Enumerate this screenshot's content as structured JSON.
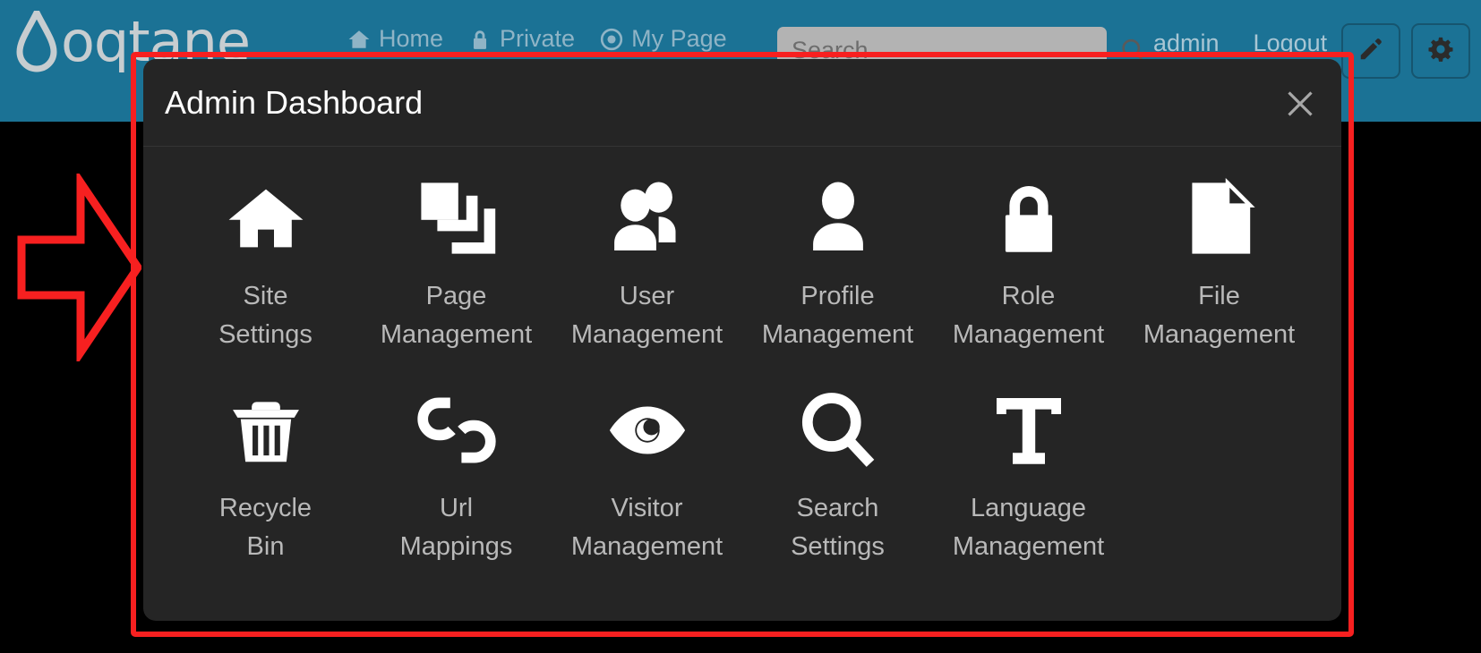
{
  "colors": {
    "header_bg": "#1b7295",
    "modal_bg": "#252525",
    "page_bg": "#000000",
    "annotation_red": "#f72020",
    "label_gray": "#b9b9b9",
    "nav_gray": "#8fb4c6",
    "icon_white": "#ffffff",
    "search_bg": "#b3b3b3"
  },
  "header": {
    "brand": {
      "wordmark": "oqtane",
      "logo_icon": "water-drop-icon"
    },
    "nav": [
      {
        "label": "Home",
        "icon": "home-icon"
      },
      {
        "label": "Private",
        "icon": "lock-icon"
      },
      {
        "label": "My Page",
        "icon": "target-circle-icon"
      }
    ],
    "search": {
      "value": "",
      "placeholder": "Search",
      "icon": "search-icon"
    },
    "user": {
      "username": "admin",
      "logout_label": "Logout"
    },
    "actions": [
      {
        "name": "edit-mode-button",
        "icon": "pencil-icon"
      },
      {
        "name": "site-settings-button",
        "icon": "gear-icon"
      }
    ]
  },
  "modal": {
    "title": "Admin Dashboard",
    "close_icon": "close-icon",
    "close_label": "×",
    "tiles": [
      {
        "label": "Site\nSettings",
        "label_line1": "Site",
        "label_line2": "Settings",
        "icon": "home-icon"
      },
      {
        "label": "Page\nManagement",
        "label_line1": "Page",
        "label_line2": "Management",
        "icon": "layers-pages-icon"
      },
      {
        "label": "User\nManagement",
        "label_line1": "User",
        "label_line2": "Management",
        "icon": "users-group-icon"
      },
      {
        "label": "Profile\nManagement",
        "label_line1": "Profile",
        "label_line2": "Management",
        "icon": "person-icon"
      },
      {
        "label": "Role\nManagement",
        "label_line1": "Role",
        "label_line2": "Management",
        "icon": "lock-icon"
      },
      {
        "label": "File\nManagement",
        "label_line1": "File",
        "label_line2": "Management",
        "icon": "file-document-icon"
      },
      {
        "label": "Recycle\nBin",
        "label_line1": "Recycle",
        "label_line2": "Bin",
        "icon": "trash-icon"
      },
      {
        "label": "Url\nMappings",
        "label_line1": "Url",
        "label_line2": "Mappings",
        "icon": "broken-link-icon"
      },
      {
        "label": "Visitor\nManagement",
        "label_line1": "Visitor",
        "label_line2": "Management",
        "icon": "eye-icon"
      },
      {
        "label": "Search\nSettings",
        "label_line1": "Search",
        "label_line2": "Settings",
        "icon": "magnifier-icon"
      },
      {
        "label": "Language\nManagement",
        "label_line1": "Language",
        "label_line2": "Management",
        "icon": "text-t-icon"
      }
    ]
  },
  "annotation": {
    "highlight_box_color": "#f72020",
    "arrow_icon": "right-arrow-outline-icon",
    "arrow_direction": "right",
    "target": "Admin Dashboard"
  }
}
